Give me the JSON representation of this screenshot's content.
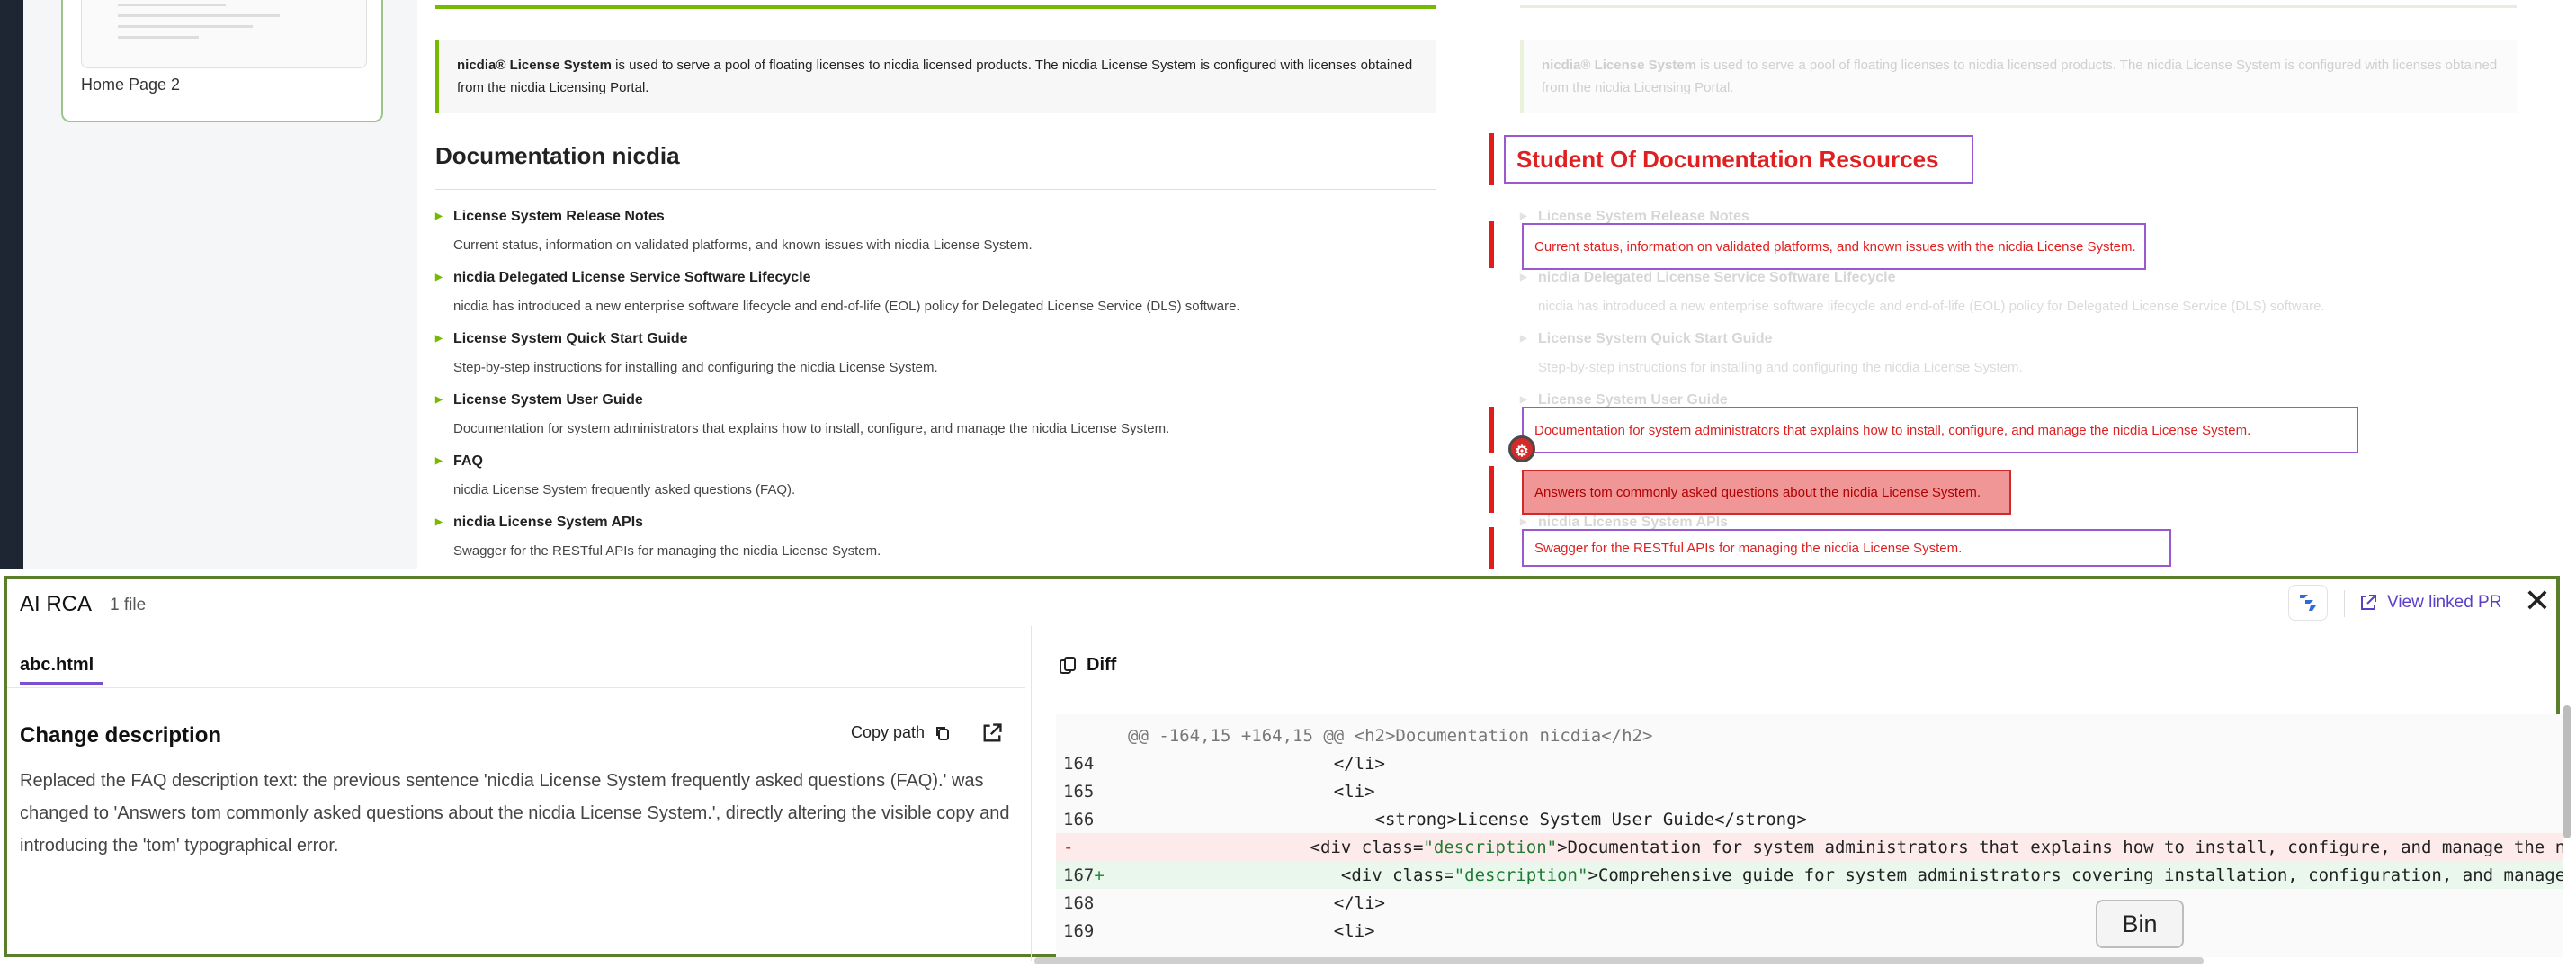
{
  "thumbnail": {
    "label": "Home Page 2"
  },
  "page": {
    "callout_brand": "nicdia® License System",
    "callout_text": " is used to serve a pool of floating licenses to nicdia licensed products. The nicdia License System is configured with licenses obtained from the nicdia Licensing Portal.",
    "heading": "Documentation nicdia",
    "items": [
      {
        "title": "License System Release Notes",
        "desc": "Current status, information on validated platforms, and known issues with nicdia License System."
      },
      {
        "title": "nicdia Delegated License Service Software Lifecycle",
        "desc": "nicdia has introduced a new enterprise software lifecycle and end-of-life (EOL) policy for Delegated License Service (DLS) software."
      },
      {
        "title": "License System Quick Start Guide",
        "desc": "Step-by-step instructions for installing and configuring the nicdia License System."
      },
      {
        "title": "License System User Guide",
        "desc": "Documentation for system administrators that explains how to install, configure, and manage the nicdia License System."
      },
      {
        "title": "FAQ",
        "desc": "nicdia License System frequently asked questions (FAQ)."
      },
      {
        "title": "nicdia License System APIs",
        "desc": "Swagger for the RESTful APIs for managing the nicdia License System."
      }
    ]
  },
  "compare": {
    "heading_diff": "Student Of Documentation Resources",
    "item1_diff": "Current status, information on validated platforms, and known issues with the nicdia License System.",
    "item4_diff": "Documentation for system administrators that explains how to install, configure, and manage the nicdia License System.",
    "item5_diff": "Answers tom commonly asked questions about the nicdia License System.",
    "item6_diff": "Swagger for the RESTful APIs for managing the nicdia License System."
  },
  "panel": {
    "title": "AI RCA",
    "count": "1 file",
    "view_pr": "View linked PR",
    "file_tab": "abc.html",
    "change_title": "Change description",
    "copy_path": "Copy path",
    "description": "Replaced the FAQ description text: the previous sentence 'nicdia License System frequently asked questions (FAQ).' was changed to 'Answers tom commonly asked questions about the nicdia License System.', directly altering the visible copy and introducing the 'tom' typographical error.",
    "diff_tab": "Diff",
    "tooltip": "Bin"
  },
  "diff": {
    "hunk": "@@ -164,15 +164,15 @@ <h2>Documentation nicdia</h2>",
    "lines": [
      {
        "num": "164",
        "sign": "",
        "type": "ctx",
        "code": "                    </li>"
      },
      {
        "num": "165",
        "sign": "",
        "type": "ctx",
        "code": "                    <li>"
      },
      {
        "num": "166",
        "sign": "",
        "type": "ctx",
        "code": "                        <strong>License System User Guide</strong>"
      },
      {
        "num": "",
        "sign": "-",
        "type": "del",
        "pre": "                       <div class=",
        "attr": "\"description\"",
        "post": ">Documentation for system administrators that explains how to install, configure, and manage the nicdia License System.</div>"
      },
      {
        "num": "167",
        "sign": "+",
        "type": "add",
        "pre": "                       <div class=",
        "attr": "\"description\"",
        "post": ">Comprehensive guide for system administrators covering installation, configuration, and management of the nicdia License System.</div>"
      },
      {
        "num": "168",
        "sign": "",
        "type": "ctx",
        "code": "                    </li>"
      },
      {
        "num": "169",
        "sign": "",
        "type": "ctx",
        "code": "                    <li>"
      }
    ]
  },
  "colors": {
    "brand_green": "#76b900",
    "panel_border": "#5a7f2a",
    "diff_red": "#e21b1b",
    "link_purple": "#5b3fc8"
  },
  "icons": [
    "bug-icon",
    "jira-icon",
    "external-link-icon",
    "close-icon",
    "copy-icon",
    "diff-icon"
  ]
}
